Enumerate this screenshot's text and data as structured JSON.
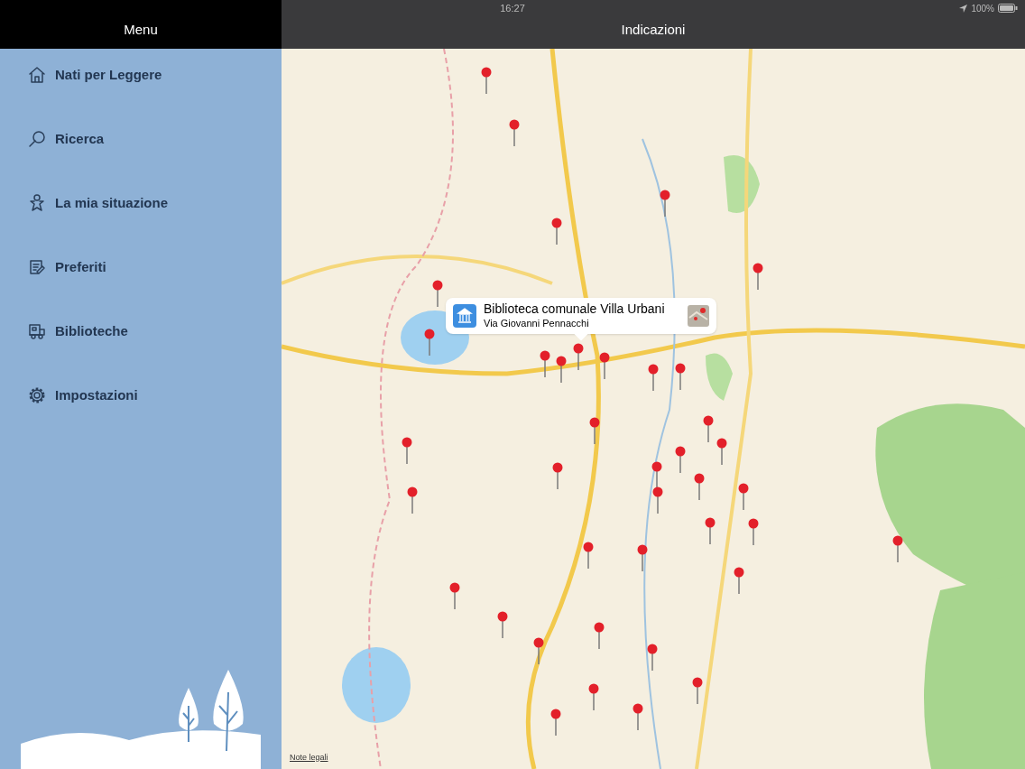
{
  "status_bar": {
    "time": "16:27",
    "battery": "100%"
  },
  "sidebar": {
    "title": "Menu",
    "items": [
      {
        "label": "Nati per Leggere"
      },
      {
        "label": "Ricerca"
      },
      {
        "label": "La mia situazione"
      },
      {
        "label": "Preferiti"
      },
      {
        "label": "Biblioteche"
      },
      {
        "label": "Impostazioni"
      }
    ]
  },
  "main": {
    "title": "Indicazioni",
    "map": {
      "kind": "picture",
      "callout": {
        "title": "Biblioteca comunale Villa Urbani",
        "subtitle": "Via Giovanni Pennacchi"
      },
      "legal_link": "Note legali"
    }
  }
}
